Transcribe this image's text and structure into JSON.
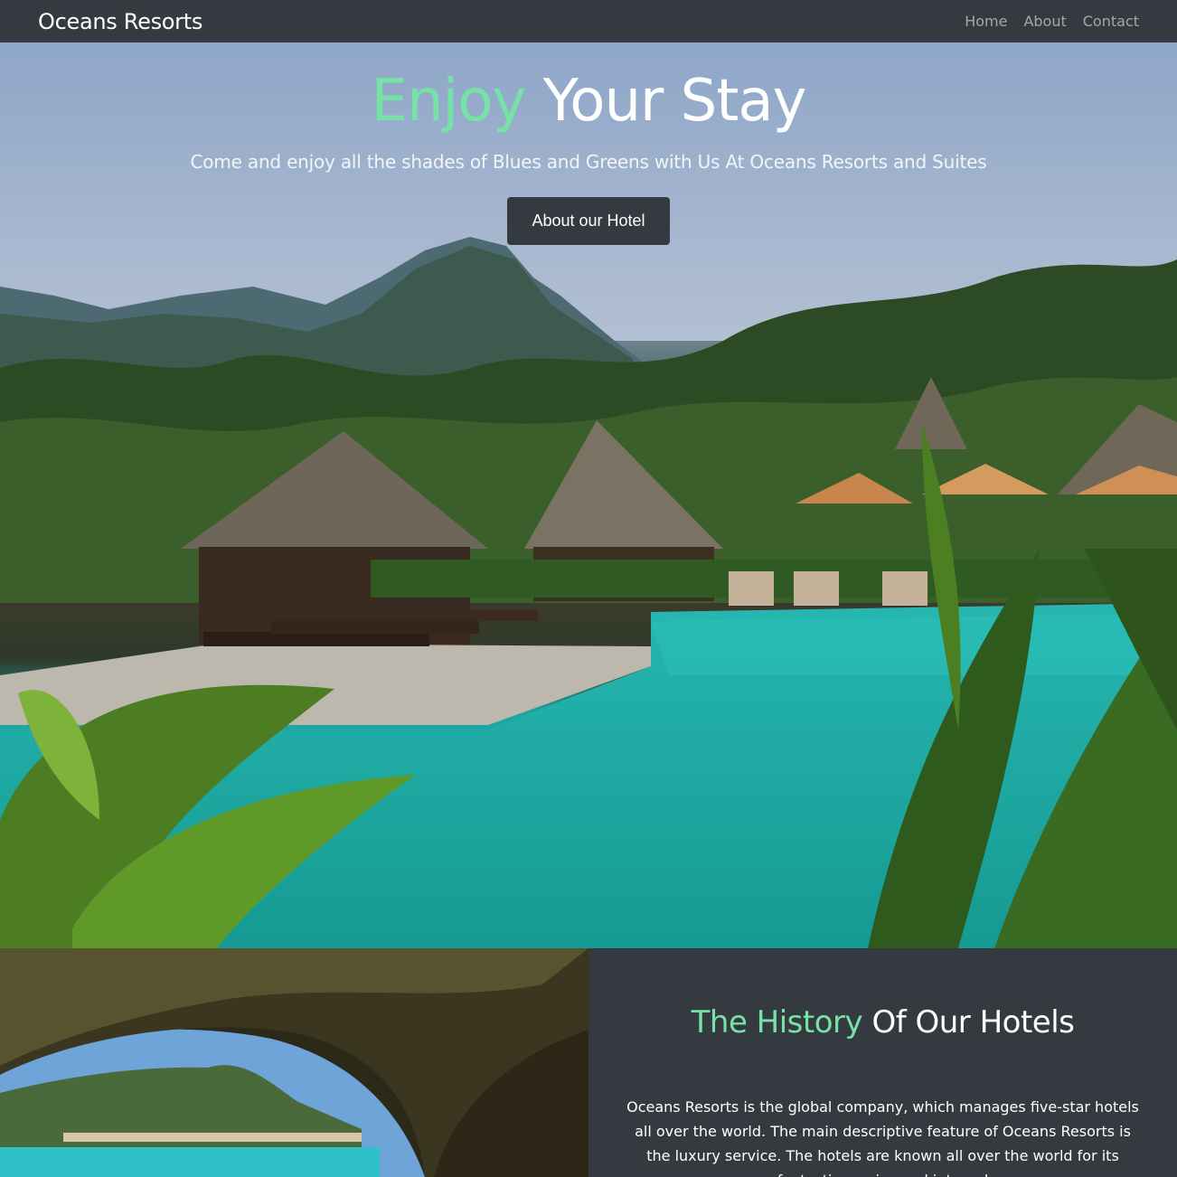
{
  "navbar": {
    "brand": "Oceans Resorts",
    "links": [
      "Home",
      "About",
      "Contact"
    ]
  },
  "hero": {
    "title_accent": "Enjoy",
    "title_rest": "Your Stay",
    "subtitle": "Come and enjoy all the shades of Blues and Greens with Us At Oceans Resorts and Suites",
    "button_label": "About our Hotel"
  },
  "history": {
    "title_accent": "The History",
    "title_rest": "Of Our Hotels",
    "body": "Oceans Resorts is the global company, which manages five-star hotels all over the world. The main descriptive feature of Oceans Resorts is the luxury service. The hotels are known all over the world for its fantastic service and internal"
  },
  "colors": {
    "accent": "#77e2a6",
    "dark": "#343a40",
    "nav_link": "rgba(255,255,255,0.55)",
    "pool": "#1fb0aa"
  }
}
